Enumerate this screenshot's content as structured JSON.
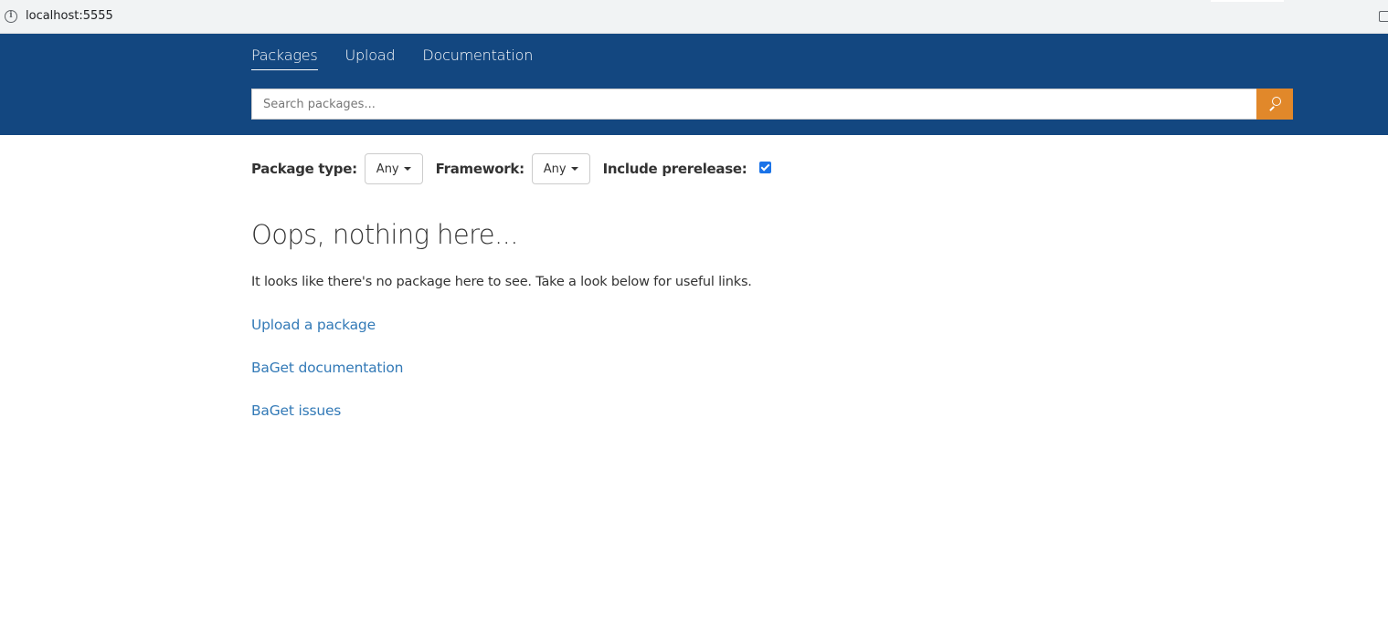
{
  "browser": {
    "url": "localhost:5555"
  },
  "navbar": {
    "links": [
      {
        "label": "Packages",
        "active": true
      },
      {
        "label": "Upload",
        "active": false
      },
      {
        "label": "Documentation",
        "active": false
      }
    ],
    "search": {
      "placeholder": "Search packages...",
      "value": ""
    }
  },
  "filters": {
    "package_type_label": "Package type:",
    "package_type_value": "Any",
    "framework_label": "Framework:",
    "framework_value": "Any",
    "prerelease_label": "Include prerelease:",
    "prerelease_checked": true
  },
  "main": {
    "heading": "Oops, nothing here...",
    "description": "It looks like there's no package here to see. Take a look below for useful links.",
    "links": [
      {
        "label": "Upload a package"
      },
      {
        "label": "BaGet documentation"
      },
      {
        "label": "BaGet issues"
      }
    ]
  },
  "colors": {
    "navbar": "#134780",
    "search_button": "#e1882a",
    "link": "#337ab7",
    "checkbox": "#1a73e8"
  },
  "icons": {
    "info": "info-icon",
    "search": "search-icon",
    "caret": "caret-down-icon"
  }
}
